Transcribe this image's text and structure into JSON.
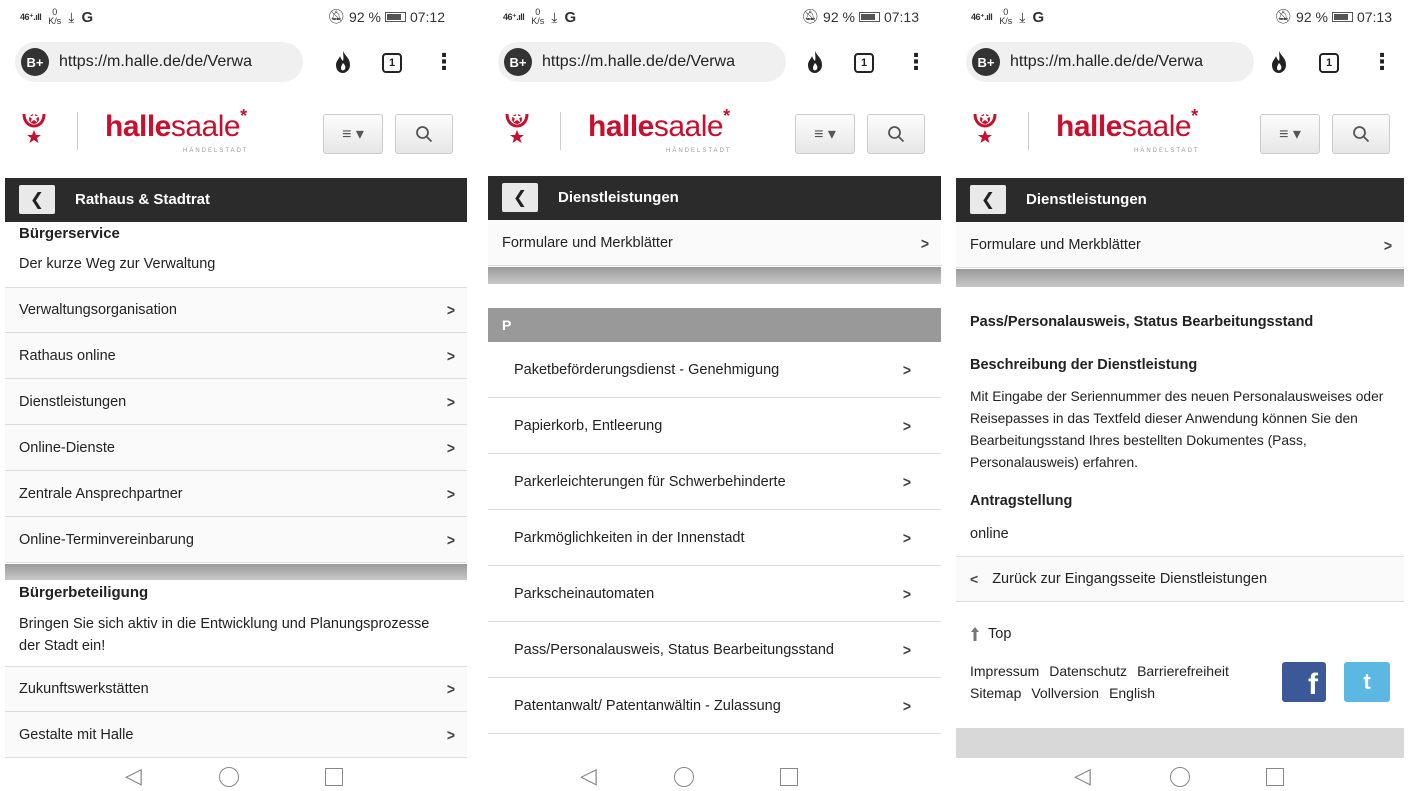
{
  "common": {
    "url": "https://m.halle.de/de/Verwa",
    "bplus": "B+",
    "tabs_count": "1",
    "kebab": "⋮",
    "logo_bold": "halle",
    "logo_light": "saale",
    "logo_star": "*",
    "logo_sub": "HÄNDELSTADT",
    "signal": "46⁺.ıll",
    "net_speed_top": "0",
    "net_speed_bottom": "K/s",
    "download": "⤓",
    "g_icon": "G",
    "battery": "92 %",
    "menu_glyph": "≡ ▾",
    "back_glyph": "❮",
    "chevron": ">",
    "back_chevron": "<",
    "nav_back": "◁",
    "brand_color": "#c8102e"
  },
  "screen1": {
    "time": "07:12",
    "nav_title": "Rathaus & Stadtrat",
    "section1_title": "Bürgerservice",
    "section1_text": "Der kurze Weg zur Verwaltung",
    "items1": [
      "Verwaltungsorganisation",
      "Rathaus online",
      "Dienstleistungen",
      "Online-Dienste",
      "Zentrale Ansprechpartner",
      "Online-Terminvereinbarung"
    ],
    "section2_title": "Bürgerbeteiligung",
    "section2_text": "Bringen Sie sich aktiv in die Entwicklung und Planungsprozesse der Stadt ein!",
    "items2": [
      "Zukunftswerkstätten",
      "Gestalte mit Halle"
    ]
  },
  "screen2": {
    "time": "07:13",
    "nav_title": "Dienstleistungen",
    "top_item": "Formulare und Merkblätter",
    "letter": "P",
    "items": [
      "Paketbeförderungsdienst - Genehmigung",
      "Papierkorb, Entleerung",
      "Parkerleichterungen für Schwerbehinderte",
      "Parkmöglichkeiten in der Innenstadt",
      "Parkscheinautomaten",
      "Pass/Personalausweis, Status Bearbeitungsstand",
      "Patentanwalt/ Patentanwältin - Zulassung"
    ]
  },
  "screen3": {
    "time": "07:13",
    "nav_title": "Dienstleistungen",
    "top_item": "Formulare und Merkblätter",
    "service_title": "Pass/Personalausweis, Status Bearbeitungsstand",
    "desc_title": "Beschreibung der Dienstleistung",
    "desc_text": "Mit Eingabe der Seriennummer des neuen Personalausweises oder Reisepasses in das Textfeld dieser Anwendung können Sie den Bearbeitungsstand Ihres bestellten Dokumentes (Pass, Personalausweis) erfahren.",
    "antrag_title": "Antragstellung",
    "antrag_text": "online",
    "back_link": "Zurück zur Eingangsseite Dienstleistungen",
    "top_link": "Top",
    "footer_row1": [
      "Impressum",
      "Datenschutz",
      "Barrierefreiheit"
    ],
    "footer_row2": [
      "Sitemap",
      "Vollversion",
      "English"
    ],
    "facebook_glyph": "f",
    "twitter_glyph": "t"
  }
}
